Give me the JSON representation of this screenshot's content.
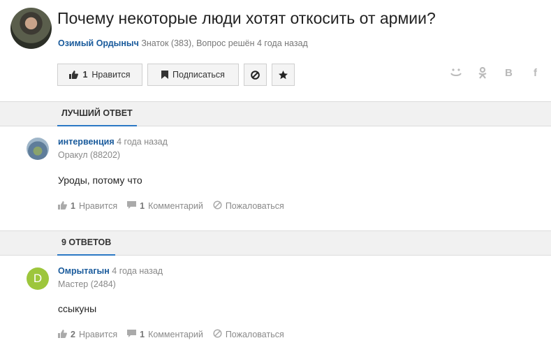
{
  "question": {
    "title": "Почему некоторые люди хотят откосить от армии?",
    "author": "Озимый Ордыныч",
    "meta": "Знаток (383), Вопрос решён 4 года назад",
    "like_count": "1",
    "like_label": "Нравится",
    "subscribe_label": "Подписаться"
  },
  "share": {
    "vk": "B",
    "fb": "f"
  },
  "best_answer": {
    "section_label": "ЛУЧШИЙ ОТВЕТ",
    "author": "интервенция",
    "time": "4 года назад",
    "rank": "Оракул (88202)",
    "text": "Уроды, потому что",
    "like_count": "1",
    "like_label": "Нравится",
    "comment_count": "1",
    "comment_label": "Комментарий",
    "report_label": "Пожаловаться"
  },
  "answers": {
    "section_label": "9 ОТВЕТОВ",
    "items": [
      {
        "avatar_letter": "D",
        "author": "Омрытагын",
        "time": "4 года назад",
        "rank": "Мастер (2484)",
        "text": "ссыкуны",
        "like_count": "2",
        "like_label": "Нравится",
        "comment_count": "1",
        "comment_label": "Комментарий",
        "report_label": "Пожаловаться"
      }
    ]
  },
  "colors": {
    "link": "#1a5b9c",
    "tab_underline": "#2b78c5",
    "letter_avatar": "#9dc63c"
  },
  "icons": [
    "thumb-up-icon",
    "bookmark-icon",
    "block-icon",
    "star-icon",
    "mail-smile-icon",
    "odnoklassniki-icon",
    "vk-icon",
    "facebook-icon",
    "comment-icon",
    "report-icon"
  ]
}
